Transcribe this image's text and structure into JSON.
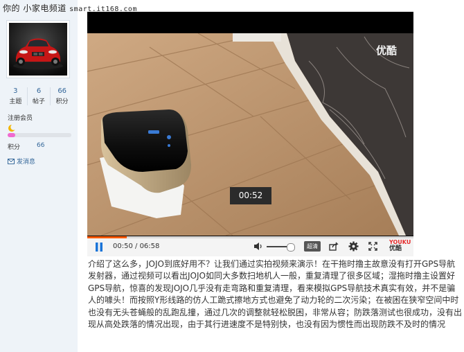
{
  "watermark": {
    "text": "你的 小家电频道",
    "url": "smart.it168.com"
  },
  "user": {
    "stats": [
      {
        "value": "3",
        "label": "主题"
      },
      {
        "value": "6",
        "label": "帖子"
      },
      {
        "value": "66",
        "label": "积分"
      }
    ],
    "rank": "注册会员",
    "rank_icon": "crescent-moon-icon",
    "progress_fraction": 0.12,
    "points_label": "积分",
    "points_value": "66",
    "message_label": "发消息",
    "message_icon": "envelope-icon"
  },
  "video": {
    "brand": "优酷",
    "seek_badge": "00:52",
    "current_time": "00:50",
    "duration": "06:58",
    "time_separator": " / ",
    "progress_fraction": 0.12,
    "volume_fraction": 0.85,
    "quality_label": "超清",
    "logo_text_top": "YOUKU",
    "logo_text_bottom": "优酷",
    "accent": "#ff5a00",
    "controls": [
      "pause-icon",
      "volume-icon",
      "share-icon",
      "settings-icon",
      "fullscreen-icon"
    ]
  },
  "article": {
    "text": "介绍了这么多，JOJO到底好用不？让我们通过实拍视频来演示！在干拖时撸主故意没有打开GPS导航发射器，通过视频可以看出JOJO如同大多数扫地机人一般，重复清理了很多区域；湿拖时撸主设置好GPS导航，惊喜的发现JOJO几乎没有走弯路和重复清理，看来模拟GPS导航技术真实有效，并不是骗人的噱头！而按照Y形线路的仿人工跪式擦地方式也避免了动力轮的二次污染；在被困在狭窄空间中时也没有无头苍蝇般的乱跑乱撞，通过几次的调整就轻松脱困，非常从容；防跌落测试也很成功，没有出现从高处跌落的情况出现，由于其行进速度不是特别快，也没有因为惯性而出现防跌不及时的情况"
  }
}
